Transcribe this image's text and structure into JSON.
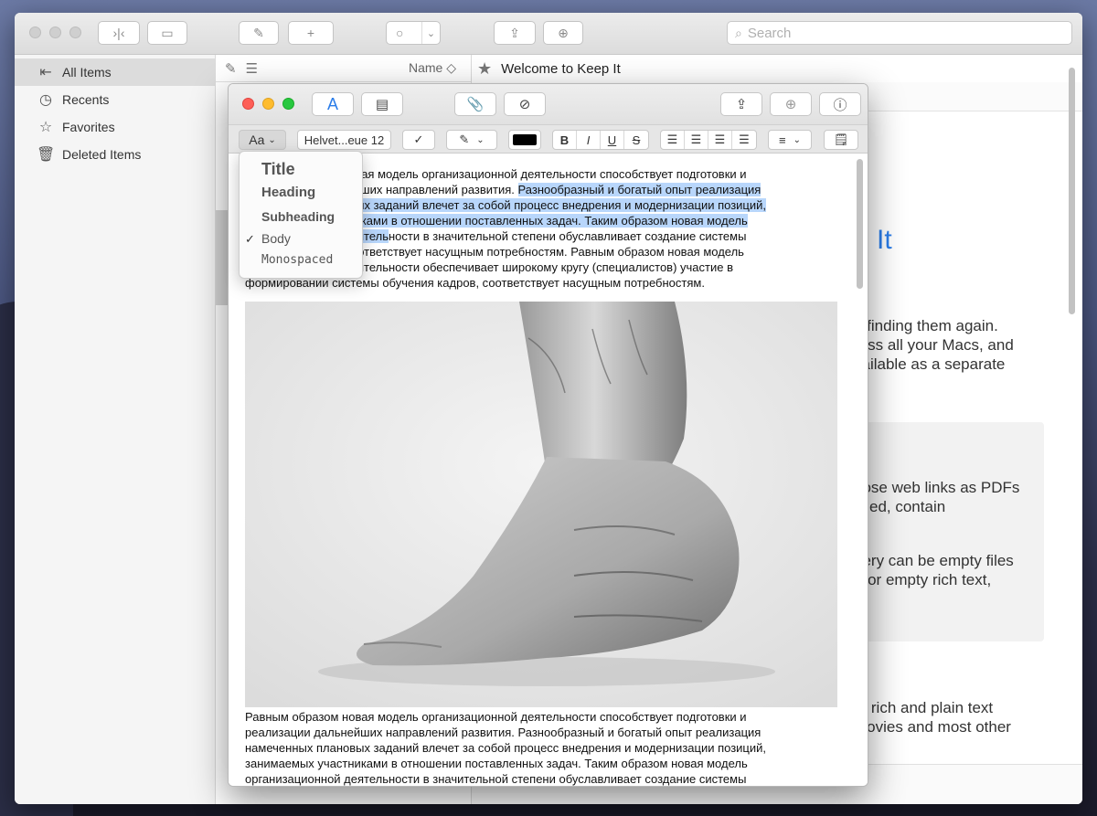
{
  "search": {
    "placeholder": "Search"
  },
  "sidebar": {
    "items": [
      {
        "label": "All Items",
        "icon": "all-items-icon"
      },
      {
        "label": "Recents",
        "icon": "clock-icon"
      },
      {
        "label": "Favorites",
        "icon": "star-icon"
      },
      {
        "label": "Deleted Items",
        "icon": "trash-icon"
      }
    ]
  },
  "list": {
    "sort_label": "Name ◇"
  },
  "note": {
    "title": "Welcome to Keep It",
    "bg_fragments": [
      "p It",
      "d finding them again.",
      "ross all your Macs, and",
      "vailable as a separate",
      "hose web links as PDFs",
      "tyled, contain",
      "hery can be empty files",
      "r for empty rich text,",
      "n, rich and plain text",
      "movies and most other"
    ]
  },
  "editor": {
    "font_label": "Helvet...eue 12",
    "style_button": "Aa",
    "paragraph1": {
      "line1": "Равным образом новая модель организационной деятельности способствует подготовки и",
      "line2_plain": "реализации дальнейших направлений развития. ",
      "line2_hl": "Разнообразный и богатый опыт реализация",
      "line3_hl": "намеченных плановых заданий влечет за собой процесс внедрения и модернизации позиций,",
      "line4_hl": "занимаемых участниками в отношении поставленных задач. Таким образом новая модель",
      "line5_hl": "организационной деятель",
      "line5_plain": "ности в значительной степени обуславливает создание системы",
      "line6": "обучения кадров, соответствует насущным потребностям. Равным образом новая модель",
      "line7": "организационной деятельности обеспечивает широкому кругу (специалистов) участие в",
      "line8": "формировании системы обучения кадров, соответствует насущным потребностям."
    },
    "paragraph2": {
      "line1": "Равным образом новая модель организационной деятельности способствует подготовки и",
      "line2": "реализации дальнейших направлений развития. Разнообразный и богатый опыт реализация",
      "line3": "намеченных плановых заданий влечет за собой процесс внедрения и модернизации позиций,",
      "line4": "занимаемых участниками в отношении поставленных задач. Таким образом новая модель",
      "line5": "организационной деятельности в значительной степени обуславливает создание системы"
    }
  },
  "style_menu": {
    "items": [
      "Title",
      "Heading",
      "Subheading",
      "Body",
      "Monospaced"
    ],
    "selected": "Body"
  },
  "colors": {
    "accent": "#2b7de9",
    "selection": "#b8d6fb",
    "traffic_red": "#fe5f57",
    "traffic_yellow": "#febc2e",
    "traffic_green": "#28c840"
  }
}
